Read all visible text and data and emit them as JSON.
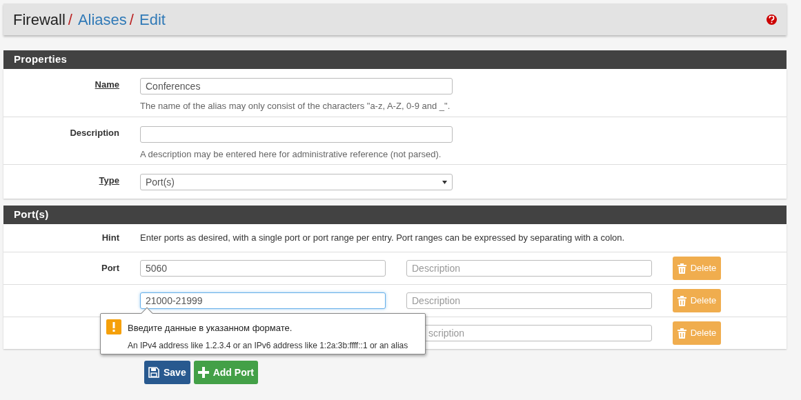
{
  "breadcrumb": [
    {
      "text": "Firewall",
      "link": false
    },
    {
      "separator": "/",
      "text": "Aliases",
      "link": true
    },
    {
      "separator": "/",
      "text": "Edit",
      "link": true
    }
  ],
  "properties": {
    "title": "Properties",
    "rows": [
      {
        "kind": "text",
        "label": "Name",
        "underlined": true,
        "value": "Conferences",
        "help": "The name of the alias may only consist of the characters \"a-z, A-Z, 0-9 and _\"."
      },
      {
        "kind": "text",
        "label": "Description",
        "underlined": false,
        "value": "",
        "help": "A description may be entered here for administrative reference (not parsed)."
      },
      {
        "kind": "select",
        "label": "Type",
        "underlined": true,
        "value": "Port(s)"
      }
    ]
  },
  "ports": {
    "title": "Port(s)",
    "hint_label": "Hint",
    "hint": "Enter ports as desired, with a single port or port range per entry. Port ranges can be expressed by separating with a colon.",
    "entries": [
      {
        "kind": "normal",
        "label": "Port",
        "value": "5060",
        "description_placeholder": "Description",
        "focused": false,
        "delete": "Delete"
      },
      {
        "kind": "normal",
        "value": "21000-21999",
        "description_placeholder": "Description",
        "focused": true,
        "delete": "Delete"
      },
      {
        "kind": "covered",
        "description_placeholder": "scription",
        "delete": "Delete"
      }
    ]
  },
  "tooltip": {
    "title": "Введите данные в указанном формате.",
    "message": "An IPv4 address like 1.2.3.4 or an IPv6 address like 1:2a:3b:ffff::1 or an alias"
  },
  "buttons": [
    {
      "kind": "save",
      "label": "Save"
    },
    {
      "kind": "add",
      "label": "Add Port"
    }
  ]
}
